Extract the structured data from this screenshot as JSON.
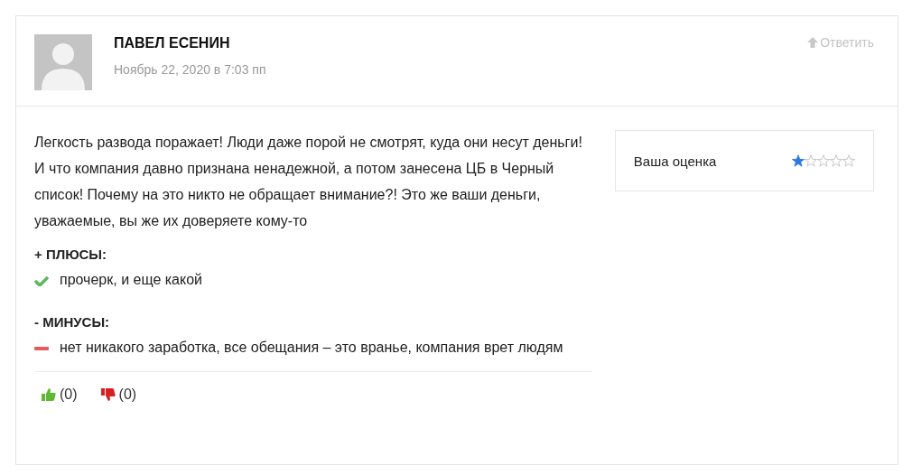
{
  "comment": {
    "author": "ПАВЕЛ ЕСЕНИН",
    "date": "Ноябрь 22, 2020 в 7:03 пп",
    "reply": "Ответить",
    "text": "Легкость развода поражает! Люди даже порой не смотрят, куда они несут деньги! И что компания давно признана ненадежной, а потом занесена ЦБ в Черный список! Почему на это никто не обращает внимание?! Это же ваши деньги, уважаемые, вы же их доверяете кому-то",
    "sections": [
      {
        "kind": "pros",
        "heading": "+ ПЛЮСЫ:",
        "items": [
          "прочерк, и еще какой"
        ]
      },
      {
        "kind": "cons",
        "heading": "- МИНУСЫ:",
        "items": [
          "нет никакого заработка, все обещания – это вранье, компания врет людям"
        ]
      }
    ],
    "votes": [
      {
        "kind": "up",
        "count": "(0)"
      },
      {
        "kind": "down",
        "count": "(0)"
      }
    ]
  },
  "rating": {
    "label": "Ваша оценка",
    "stars": 1
  }
}
